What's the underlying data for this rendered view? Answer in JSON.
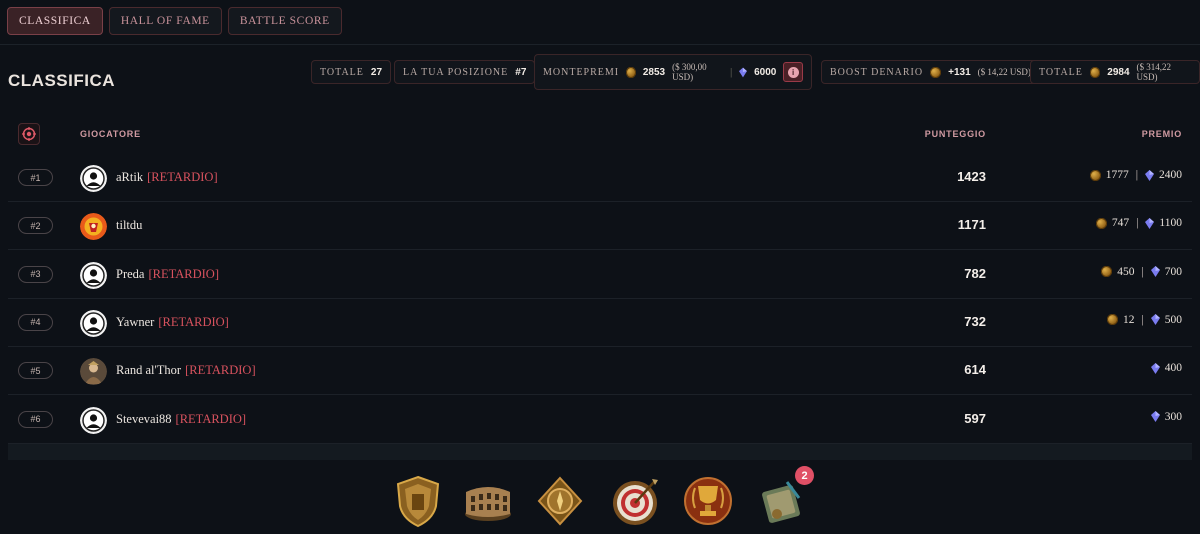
{
  "tabs": [
    {
      "label": "CLASSIFICA",
      "active": true
    },
    {
      "label": "HALL OF FAME",
      "active": false
    },
    {
      "label": "BATTLE SCORE",
      "active": false
    }
  ],
  "page_title": "CLASSIFICA",
  "stats": {
    "totale_label": "TOTALE",
    "totale_value": "27",
    "posizione_label": "LA TUA POSIZIONE",
    "posizione_value": "#7",
    "montepremi_label": "MONTEPREMI",
    "montepremi_coins": "2853",
    "montepremi_usd": "($ 300,00 USD)",
    "montepremi_gems": "6000",
    "boost_label": "BOOST DENARIO",
    "boost_coins": "+131",
    "boost_usd": "($ 14,22 USD)",
    "totale2_label": "TOTALE",
    "totale2_coins": "2984",
    "totale2_usd": "($ 314,22 USD)"
  },
  "table": {
    "col_player": "GIOCATORE",
    "col_score": "PUNTEGGIO",
    "col_prize": "PREMIO",
    "rows": [
      {
        "rank": "#1",
        "name": "aRtik",
        "tag": "[RETARDIO]",
        "score": "1423",
        "coins": "1777",
        "gems": "2400",
        "avatar": "default"
      },
      {
        "rank": "#2",
        "name": "tiltdu",
        "tag": "",
        "score": "1171",
        "coins": "747",
        "gems": "1100",
        "avatar": "emblem"
      },
      {
        "rank": "#3",
        "name": "Preda",
        "tag": "[RETARDIO]",
        "score": "782",
        "coins": "450",
        "gems": "700",
        "avatar": "default"
      },
      {
        "rank": "#4",
        "name": "Yawner",
        "tag": "[RETARDIO]",
        "score": "732",
        "coins": "12",
        "gems": "500",
        "avatar": "default"
      },
      {
        "rank": "#5",
        "name": "Rand al'Thor",
        "tag": "[RETARDIO]",
        "score": "614",
        "coins": "",
        "gems": "400",
        "avatar": "warrior"
      },
      {
        "rank": "#6",
        "name": "Stevevai88",
        "tag": "[RETARDIO]",
        "score": "597",
        "coins": "",
        "gems": "300",
        "avatar": "default"
      }
    ]
  },
  "dock": {
    "items": [
      "shield-icon",
      "colosseum-icon",
      "compass-icon",
      "target-icon",
      "trophy-icon",
      "scroll-icon"
    ],
    "badge_count": "2"
  },
  "colors": {
    "background": "#0d1117",
    "accent": "#d8525e",
    "tab_active": "#3a2226",
    "header_text": "#d09aa2"
  }
}
